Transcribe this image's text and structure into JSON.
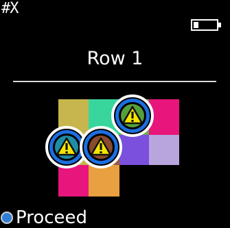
{
  "status": {
    "label": "#X",
    "battery_icon": "battery-low-icon"
  },
  "screen": {
    "title": "Row 1"
  },
  "grid": {
    "cells": [
      {
        "name": "grid-cell-olive",
        "color": "#c7b64e"
      },
      {
        "name": "grid-cell-mint",
        "color": "#38d69d"
      },
      {
        "name": "grid-cell-pink",
        "color": "#e8167c"
      },
      {
        "name": "grid-cell-violet",
        "color": "#7a50dd"
      },
      {
        "name": "grid-cell-lavender",
        "color": "#b8a5dd"
      },
      {
        "name": "grid-cell-pink-bottom",
        "color": "#e8167c"
      },
      {
        "name": "grid-cell-orange",
        "color": "#e8a040"
      }
    ],
    "warning_icon": "warning-icon"
  },
  "footer": {
    "label": "Proceed",
    "button_icon": "circle-button-icon",
    "button_color": "#2f7fd4"
  }
}
